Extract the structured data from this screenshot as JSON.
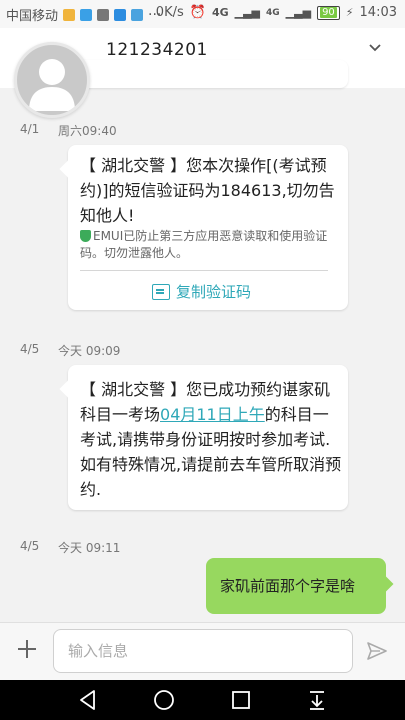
{
  "status_bar": {
    "carrier": "中国移动",
    "speed": "0K/s",
    "network1": "4G",
    "network2": "4G",
    "battery": "90",
    "time": "14:03"
  },
  "header": {
    "contact": "121234201"
  },
  "messages": [
    {
      "date": "4/1",
      "time": "周六09:40",
      "text": "【 湖北交警 】您本次操作[(考试预约)]的短信验证码为184613,切勿告知他人!",
      "note": "EMUI已防止第三方应用恶意读取和使用验证码。切勿泄露他人。",
      "action": "复制验证码"
    },
    {
      "date": "4/5",
      "time": "今天 09:09",
      "text_before": "【 湖北交警 】您已成功预约谌家矶科目一考场",
      "link": "04月11日上午",
      "text_after": "的科目一考试,请携带身份证明按时参加考试.如有特殊情况,请提前去车管所取消预约."
    },
    {
      "date": "4/5",
      "time": "今天 09:11",
      "outgoing_text": "家矶前面那个字是啥"
    }
  ],
  "compose": {
    "placeholder": "输入信息"
  },
  "icons": {
    "chevron": "chevron-down-icon",
    "plus": "plus-icon",
    "send": "send-icon",
    "back": "nav-back-icon",
    "home": "nav-home-icon",
    "recents": "nav-recents-icon",
    "notifications": "nav-notification-icon"
  },
  "colors": {
    "outgoing_bubble": "#97d85f",
    "link": "#2fa8b8",
    "navbar": "#000000"
  }
}
